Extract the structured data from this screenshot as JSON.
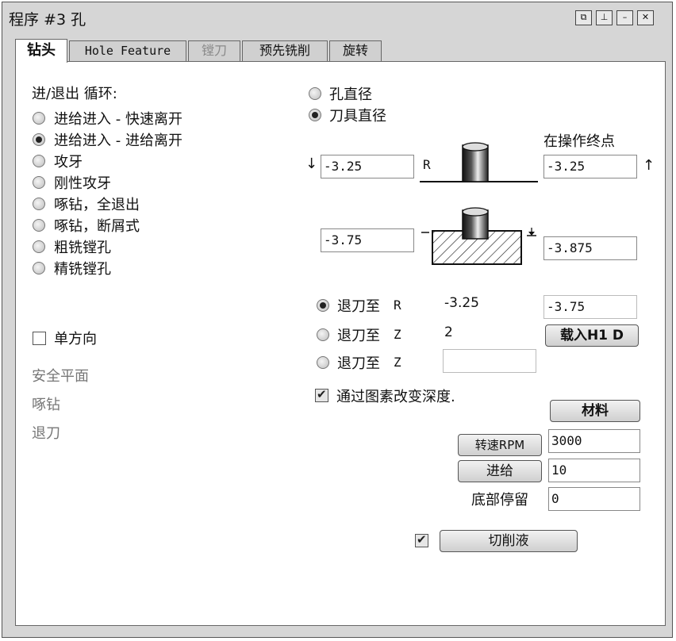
{
  "window": {
    "title": "程序 #3 孔",
    "controls": [
      "restore",
      "pin",
      "minimize",
      "close"
    ]
  },
  "tabs": [
    {
      "label": "钻头",
      "active": true
    },
    {
      "label": "Hole Feature",
      "active": false
    },
    {
      "label": "镗刀",
      "active": false,
      "disabled": true
    },
    {
      "label": "预先铣削",
      "active": false
    },
    {
      "label": "旋转",
      "active": false
    }
  ],
  "cycle": {
    "heading": "进/退出 循环:",
    "options": [
      {
        "label": "进给进入 - 快速离开",
        "selected": false
      },
      {
        "label": "进给进入 - 进给离开",
        "selected": true
      },
      {
        "label": "攻牙",
        "selected": false
      },
      {
        "label": "刚性攻牙",
        "selected": false
      },
      {
        "label": "啄钻，全退出",
        "selected": false
      },
      {
        "label": "啄钻，断屑式",
        "selected": false
      },
      {
        "label": "粗铣镗孔",
        "selected": false
      },
      {
        "label": "精铣镗孔",
        "selected": false
      }
    ]
  },
  "one_direction": {
    "label": "单方向",
    "checked": false
  },
  "disabled_labels": [
    "安全平面",
    "啄钻",
    "退刀"
  ],
  "diameter": {
    "options": [
      {
        "label": "孔直径",
        "selected": false
      },
      {
        "label": "刀具直径",
        "selected": true
      }
    ]
  },
  "depth": {
    "end_label": "在操作终点",
    "top_left": "-3.25",
    "r_label": "R",
    "top_right": "-3.25",
    "bottom_left": "-3.75",
    "bottom_right": "-3.875"
  },
  "retract": {
    "options": [
      {
        "label": "退刀至",
        "axis": "R",
        "value": "-3.25",
        "selected": true
      },
      {
        "label": "退刀至",
        "axis": "Z",
        "value": "2",
        "selected": false
      },
      {
        "label": "退刀至",
        "axis": "Z",
        "value": "",
        "selected": false
      }
    ],
    "right_value": "-3.75",
    "load_button": "载入H1 D"
  },
  "change_depth": {
    "label": "通过图素改变深度.",
    "checked": true
  },
  "material_button": "材料",
  "speed": {
    "label": "转速RPM",
    "value": "3000"
  },
  "feed": {
    "label": "进给",
    "value": "10"
  },
  "dwell": {
    "label": "底部停留",
    "value": "0"
  },
  "coolant": {
    "label": "切削液",
    "checked": true
  }
}
